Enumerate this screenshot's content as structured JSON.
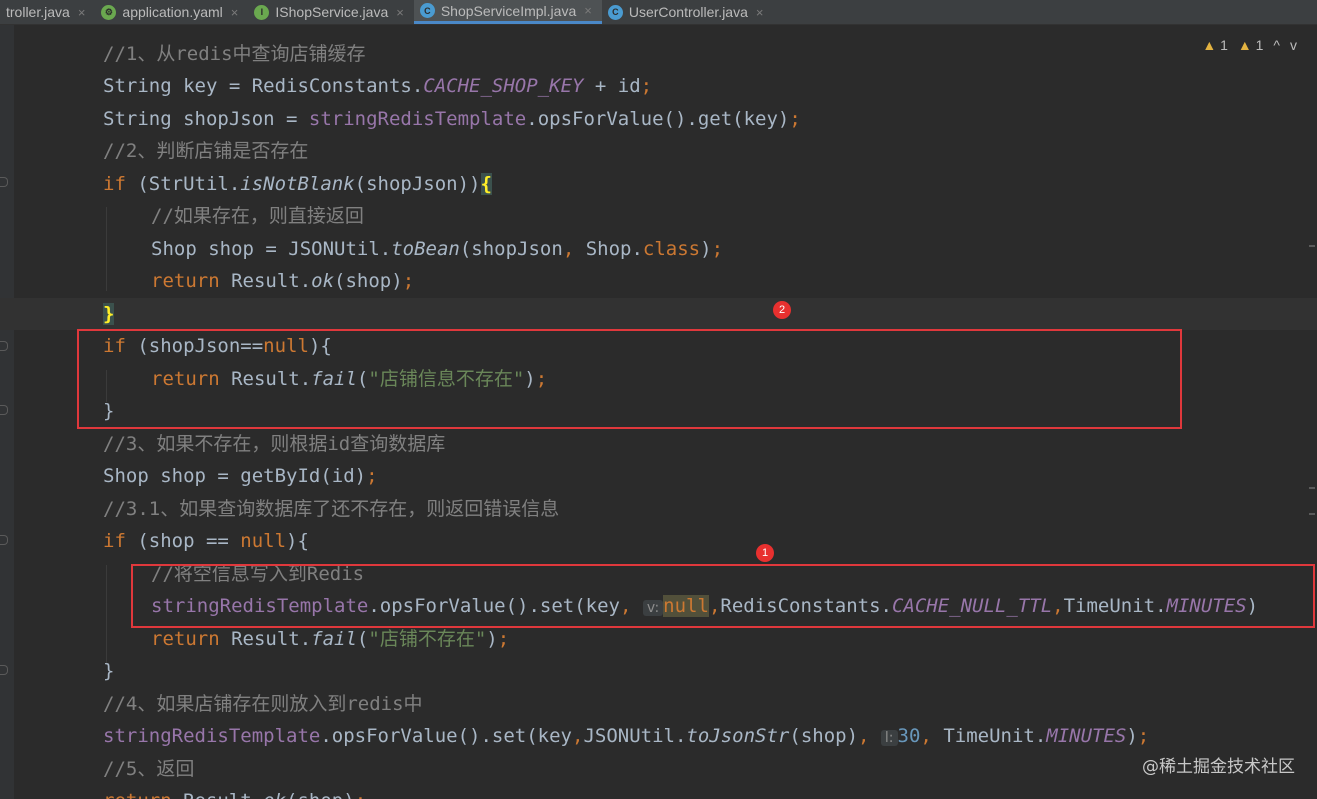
{
  "tabs": [
    {
      "label": "troller.java",
      "icon": "class-icon",
      "color": "#4a9bd1",
      "active": false
    },
    {
      "label": "application.yaml",
      "icon": "spring-yaml-icon",
      "color": "#6aa84f",
      "active": false
    },
    {
      "label": "IShopService.java",
      "icon": "interface-icon",
      "color": "#6aa84f",
      "active": false
    },
    {
      "label": "ShopServiceImpl.java",
      "icon": "class-icon",
      "color": "#4a9bd1",
      "active": true
    },
    {
      "label": "UserController.java",
      "icon": "class-icon",
      "color": "#4a9bd1",
      "active": false
    }
  ],
  "inspection": {
    "warnings_1": "1",
    "warnings_2": "1",
    "up": "^",
    "down": "v"
  },
  "code": {
    "c1": "//1、从redis中查询店铺缓存",
    "l2": {
      "a": "String key = RedisConstants.",
      "b": "CACHE_SHOP_KEY",
      "c": " + id",
      "d": ";"
    },
    "l3": {
      "a": "String shopJson = ",
      "b": "stringRedisTemplate",
      "c": ".opsForValue().get(key)",
      "d": ";"
    },
    "c4": "//2、判断店铺是否存在",
    "l5": {
      "a": "if",
      "b": " (StrUtil.",
      "c": "isNotBlank",
      "d": "(shopJson))",
      "e": "{"
    },
    "c6": "//如果存在，则直接返回",
    "l7": {
      "a": "Shop shop = JSONUtil.",
      "b": "toBean",
      "c": "(shopJson",
      "d": ",",
      "e": " Shop.",
      "f": "class",
      "g": ")",
      "h": ";"
    },
    "l8": {
      "a": "return",
      "b": " Result.",
      "c": "ok",
      "d": "(shop)",
      "e": ";"
    },
    "l9": "}",
    "l10": {
      "a": "if",
      "b": " (shopJson==",
      "c": "null",
      "d": "){"
    },
    "l11": {
      "a": "return",
      "b": " Result.",
      "c": "fail",
      "d": "(",
      "e": "\"店铺信息不存在\"",
      "f": ")",
      "g": ";"
    },
    "l12": "}",
    "c13": "//3、如果不存在，则根据id查询数据库",
    "l14": {
      "a": "Shop shop = getById(id)",
      "b": ";"
    },
    "c15": "//3.1、如果查询数据库了还不存在，则返回错误信息",
    "l16": {
      "a": "if",
      "b": " (shop == ",
      "c": "null",
      "d": "){"
    },
    "c17": "//将空信息写入到Redis",
    "l18": {
      "a": "stringRedisTemplate",
      "b": ".opsForValue().set(key",
      "c": ",",
      "hint": "v:",
      "d": "null",
      "e": ",",
      "f": "RedisConstants.",
      "g": "CACHE_NULL_TTL",
      "h": ",",
      "i": "TimeUnit.",
      "j": "MINUTES",
      "k": ")"
    },
    "l19": {
      "a": "return",
      "b": " Result.",
      "c": "fail",
      "d": "(",
      "e": "\"店铺不存在\"",
      "f": ")",
      "g": ";"
    },
    "l20": "}",
    "c21": "//4、如果店铺存在则放入到redis中",
    "l22": {
      "a": "stringRedisTemplate",
      "b": ".opsForValue().set(key",
      "c": ",",
      "d": "JSONUtil.",
      "e": "toJsonStr",
      "f": "(shop)",
      "g": ",",
      "hint": "l:",
      "h": "30",
      "i": ",",
      "j": " TimeUnit.",
      "k": "MINUTES",
      "l": ")",
      "m": ";"
    },
    "c23": "//5、返回",
    "l24": {
      "a": "return",
      "b": " Result.",
      "c": "ok",
      "d": "(shop)",
      "e": ";"
    }
  },
  "annotations": {
    "badge_1": "1",
    "badge_2": "2"
  },
  "watermark": "@稀土掘金技术社区",
  "colors": {
    "background": "#2b2b2b",
    "keyword": "#cc7832",
    "comment": "#808080",
    "string": "#6a8759",
    "field": "#9876aa",
    "annotation_box": "#e0383c"
  }
}
